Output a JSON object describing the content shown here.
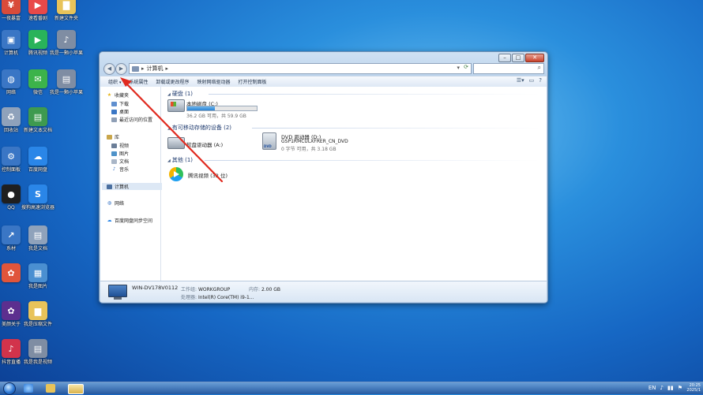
{
  "desktop": {
    "icons": [
      {
        "label": "一夜暴富",
        "glyph": "¥",
        "color": "#d84b3a"
      },
      {
        "label": "速看番剧",
        "glyph": "▶",
        "color": "#e94949"
      },
      {
        "label": "新建文件夹",
        "glyph": "▇",
        "color": "#e8c35a"
      },
      {
        "label": "计算机",
        "glyph": "▣",
        "color": "#3a76c5"
      },
      {
        "label": "腾讯视频",
        "glyph": "▶",
        "color": "#29b35a"
      },
      {
        "label": "我是一颗小苹果",
        "glyph": "♪",
        "color": "#7f8da3"
      },
      {
        "label": "网络",
        "glyph": "◍",
        "color": "#3a76c5"
      },
      {
        "label": "微信",
        "glyph": "✉",
        "color": "#3cb34a"
      },
      {
        "label": "我是一颗小苹果",
        "glyph": "▤",
        "color": "#7f8da3"
      },
      {
        "label": "回收站",
        "glyph": "♻",
        "color": "#8fa2bb"
      },
      {
        "label": "新建文本文档",
        "glyph": "▤",
        "color": "#3e9a4f"
      },
      {
        "label": "控制面板",
        "glyph": "⚙",
        "color": "#3a76c5"
      },
      {
        "label": "百度网盘",
        "glyph": "☁",
        "color": "#2a86e8"
      },
      {
        "label": "QQ",
        "glyph": "●",
        "color": "#1f1f1f"
      },
      {
        "label": "搜狗高速浏览器",
        "glyph": "S",
        "color": "#2a86e8"
      },
      {
        "label": "系材",
        "glyph": "↗",
        "color": "#3a76c5"
      },
      {
        "label": "我是文档",
        "glyph": "▤",
        "color": "#8fa2bb"
      },
      {
        "label": "",
        "glyph": "✿",
        "color": "#e0553b"
      },
      {
        "label": "我是图片",
        "glyph": "▦",
        "color": "#4a8fd1"
      },
      {
        "label": "美颜关于",
        "glyph": "✿",
        "color": "#5c2f8f"
      },
      {
        "label": "我是压缩文件",
        "glyph": "▆",
        "color": "#e8c35a"
      },
      {
        "label": "抖音直播",
        "glyph": "♪",
        "color": "#d2334b"
      },
      {
        "label": "我是我是视频",
        "glyph": "▤",
        "color": "#7f8da3"
      }
    ]
  },
  "window": {
    "address": "计算机",
    "search_placeholder": "",
    "toolbar": {
      "organize": "组织",
      "system_props": "系统属性",
      "uninstall": "卸载或更改程序",
      "map_drive": "映射网络驱动器",
      "control_panel": "打开控制面板"
    },
    "nav": {
      "favorites": "收藏夹",
      "downloads": "下载",
      "desktop": "桌面",
      "recent": "最近访问的位置",
      "libraries": "库",
      "videos": "视频",
      "pictures": "图片",
      "documents": "文档",
      "music": "音乐",
      "computer": "计算机",
      "network": "网络",
      "baidu": "百度网盘同步空间"
    },
    "groups": {
      "hard_disk": "硬盘 (1)",
      "removable": "有可移动存储的设备 (2)",
      "other": "其他 (1)"
    },
    "drives": {
      "c": {
        "name": "本地磁盘 (C:)",
        "free": "36.2 GB 可用，共 59.9 GB",
        "used_fraction": 0.4
      },
      "a": {
        "name": "软盘驱动器 (A:)"
      },
      "dvd": {
        "name": "DVD 驱动器 (D:)",
        "label": "GSP1RMCULXFRER_CN_DVD",
        "free": "0 字节 可用，共 3.18 GB"
      },
      "tencent": {
        "name": "腾讯视频 (32 位)"
      }
    },
    "details": {
      "computer_name": "WIN-DV178V0112",
      "workgroup_label": "工作组:",
      "workgroup": "WORKGROUP",
      "memory_label": "内存:",
      "memory": "2.00 GB",
      "cpu_label": "处理器:",
      "cpu": "Intel(R) Core(TM) i9-1..."
    }
  },
  "taskbar": {
    "tray": [
      "EN",
      "♪",
      "▮▮",
      "⚑"
    ],
    "time": "20:25",
    "date": "2025/1"
  },
  "colors": {
    "arrow": "#e02a1f",
    "accent": "#2b83d3"
  }
}
